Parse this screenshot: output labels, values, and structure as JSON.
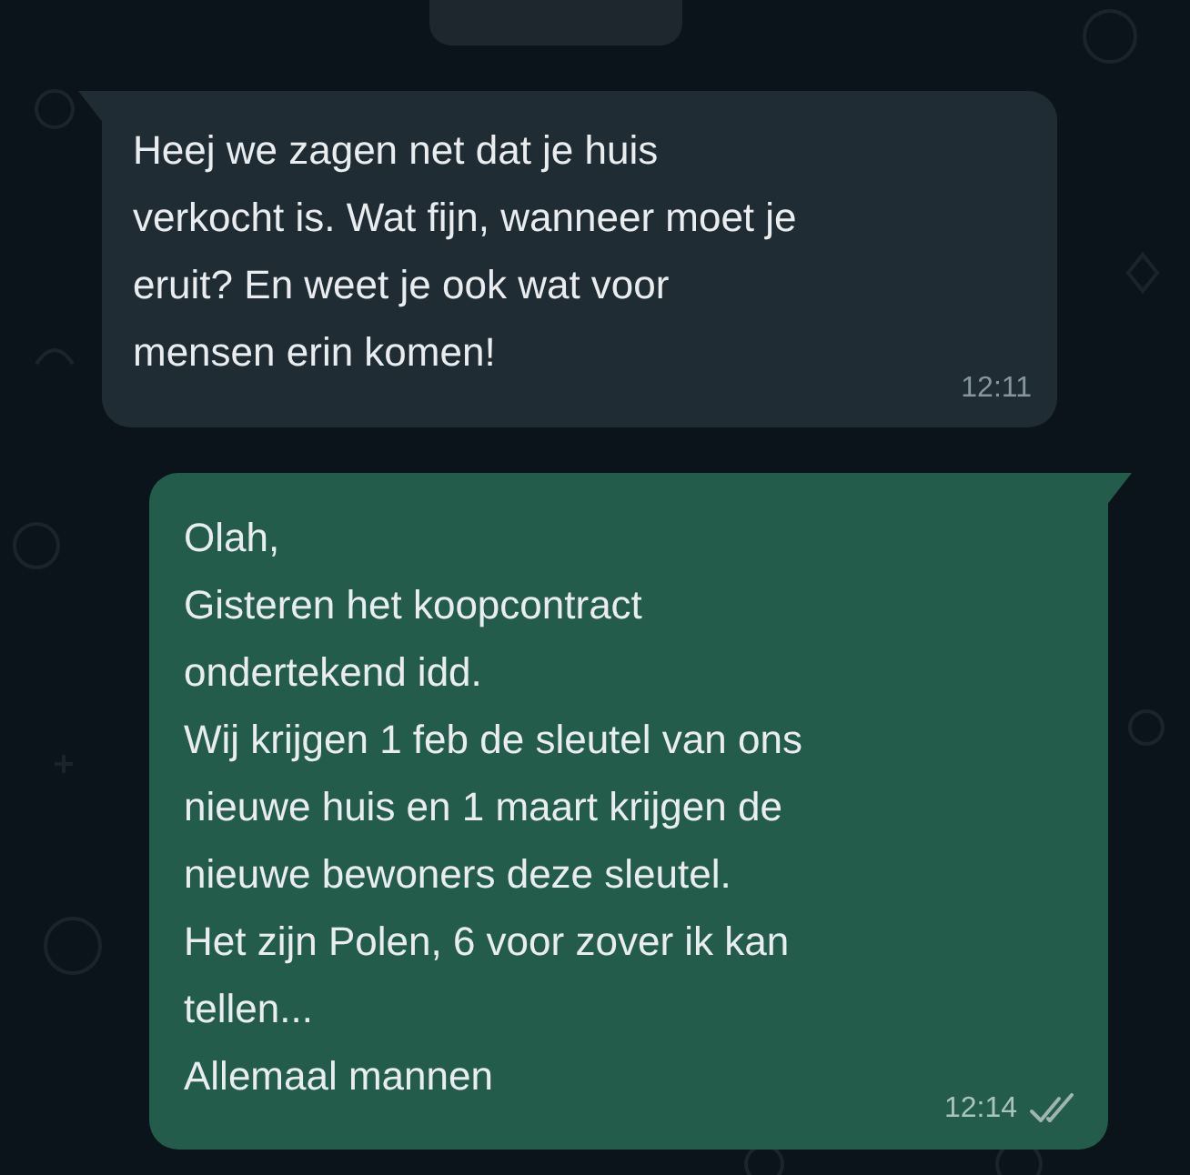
{
  "messages": [
    {
      "kind": "incoming",
      "text": "Heej we zagen net dat je huis\nverkocht is. Wat fijn, wanneer moet je\neruit? En weet je ook wat voor\nmensen erin komen!",
      "time": "12:11"
    },
    {
      "kind": "outgoing",
      "text": "Olah,\nGisteren het koopcontract\nondertekend idd.\nWij krijgen 1 feb de sleutel van ons\nnieuwe huis en 1 maart krijgen de\nnieuwe bewoners deze sleutel.\nHet zijn Polen, 6 voor zover ik kan\ntellen...\nAllemaal mannen",
      "time": "12:14",
      "read": false
    }
  ]
}
